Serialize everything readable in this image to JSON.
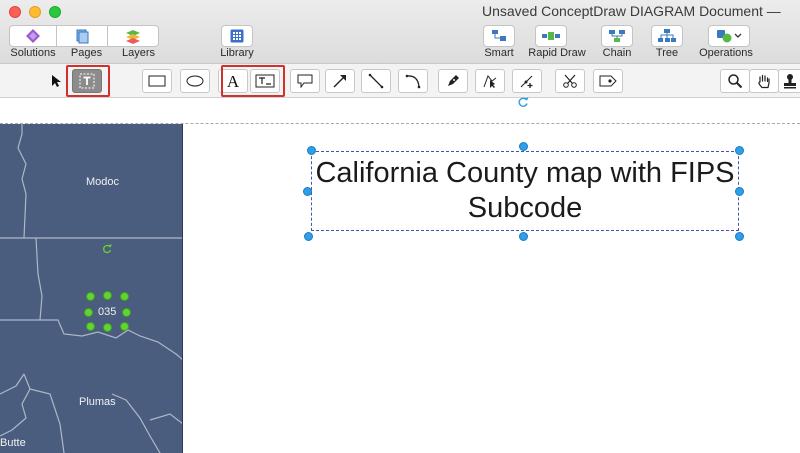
{
  "window": {
    "title": "Unsaved ConceptDraw DIAGRAM Document —"
  },
  "toolbar": {
    "solutions": "Solutions",
    "pages": "Pages",
    "layers": "Layers",
    "library": "Library",
    "smart": "Smart",
    "rapid_draw": "Rapid Draw",
    "chain": "Chain",
    "tree": "Tree",
    "operations": "Operations"
  },
  "drawing_tools": [
    "selection-arrow",
    "text-block-tool",
    "rectangle",
    "ellipse",
    "text",
    "text-box",
    "callout",
    "arrow",
    "line",
    "arc",
    "pen",
    "direct-selection",
    "add-point",
    "scissors",
    "insert-image",
    "zoom",
    "hand",
    "stamp"
  ],
  "canvas": {
    "textbox_text": "California County map with FIPS Subcode"
  },
  "map": {
    "counties": [
      "Modoc",
      "035",
      "Plumas",
      "Butte"
    ],
    "fill_color": "#4b5d7e"
  },
  "colors": {
    "highlight": "#d0312d",
    "selection": "#3e55b7",
    "handle": "#2e9ee8",
    "green_handle": "#62d234"
  }
}
